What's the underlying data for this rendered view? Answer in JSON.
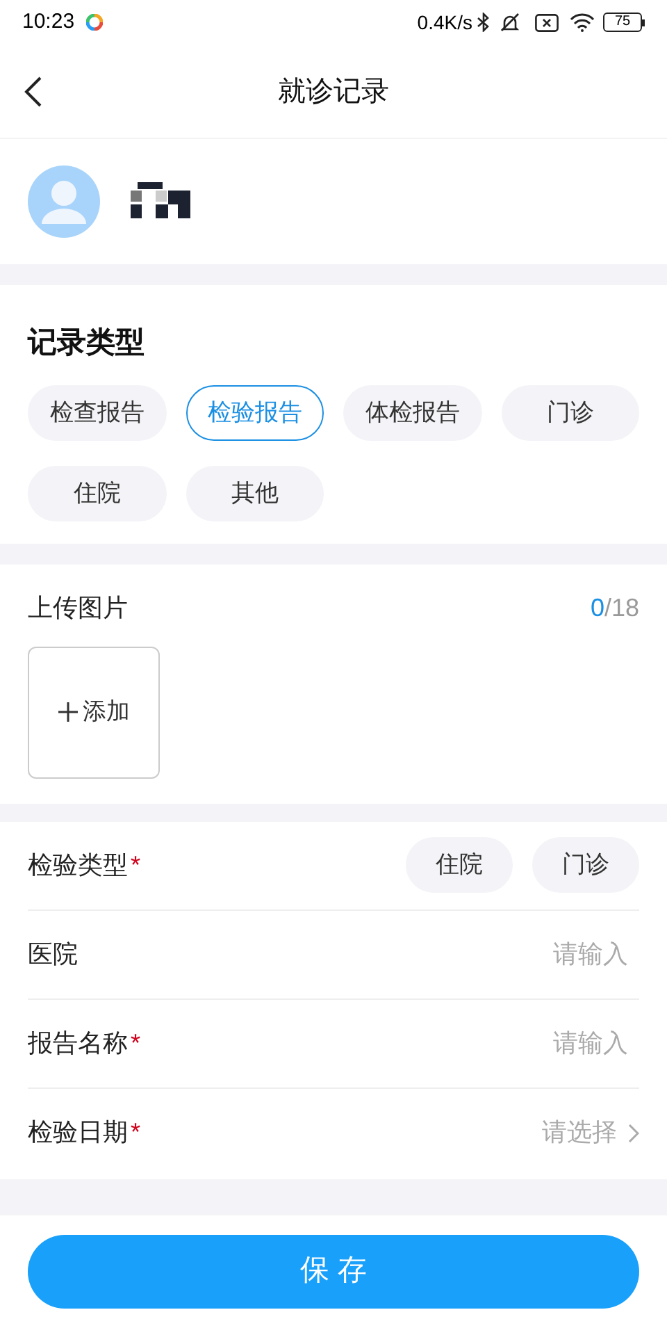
{
  "status_bar": {
    "time": "10:23",
    "net_speed": "0.4K/s",
    "battery": "75"
  },
  "header": {
    "title": "就诊记录"
  },
  "record_type": {
    "title": "记录类型",
    "options": [
      {
        "label": "检查报告",
        "selected": false
      },
      {
        "label": "检验报告",
        "selected": true
      },
      {
        "label": "体检报告",
        "selected": false
      },
      {
        "label": "门诊",
        "selected": false
      },
      {
        "label": "住院",
        "selected": false
      },
      {
        "label": "其他",
        "selected": false
      }
    ]
  },
  "upload": {
    "title": "上传图片",
    "count": "0",
    "max": "/18",
    "add_label": "添加"
  },
  "form": [
    {
      "kind": "choice",
      "label": "检验类型",
      "required_mark": "*",
      "options": [
        {
          "label": "住院",
          "selected": false
        },
        {
          "label": "门诊",
          "selected": false
        }
      ]
    },
    {
      "kind": "input",
      "label": "医院",
      "placeholder": "请输入"
    },
    {
      "kind": "input",
      "label": "报告名称",
      "required_mark": "*",
      "placeholder": "请输入"
    },
    {
      "kind": "select",
      "label": "检验日期",
      "required_mark": "*",
      "placeholder": "请选择"
    }
  ],
  "save_button": "保 存"
}
